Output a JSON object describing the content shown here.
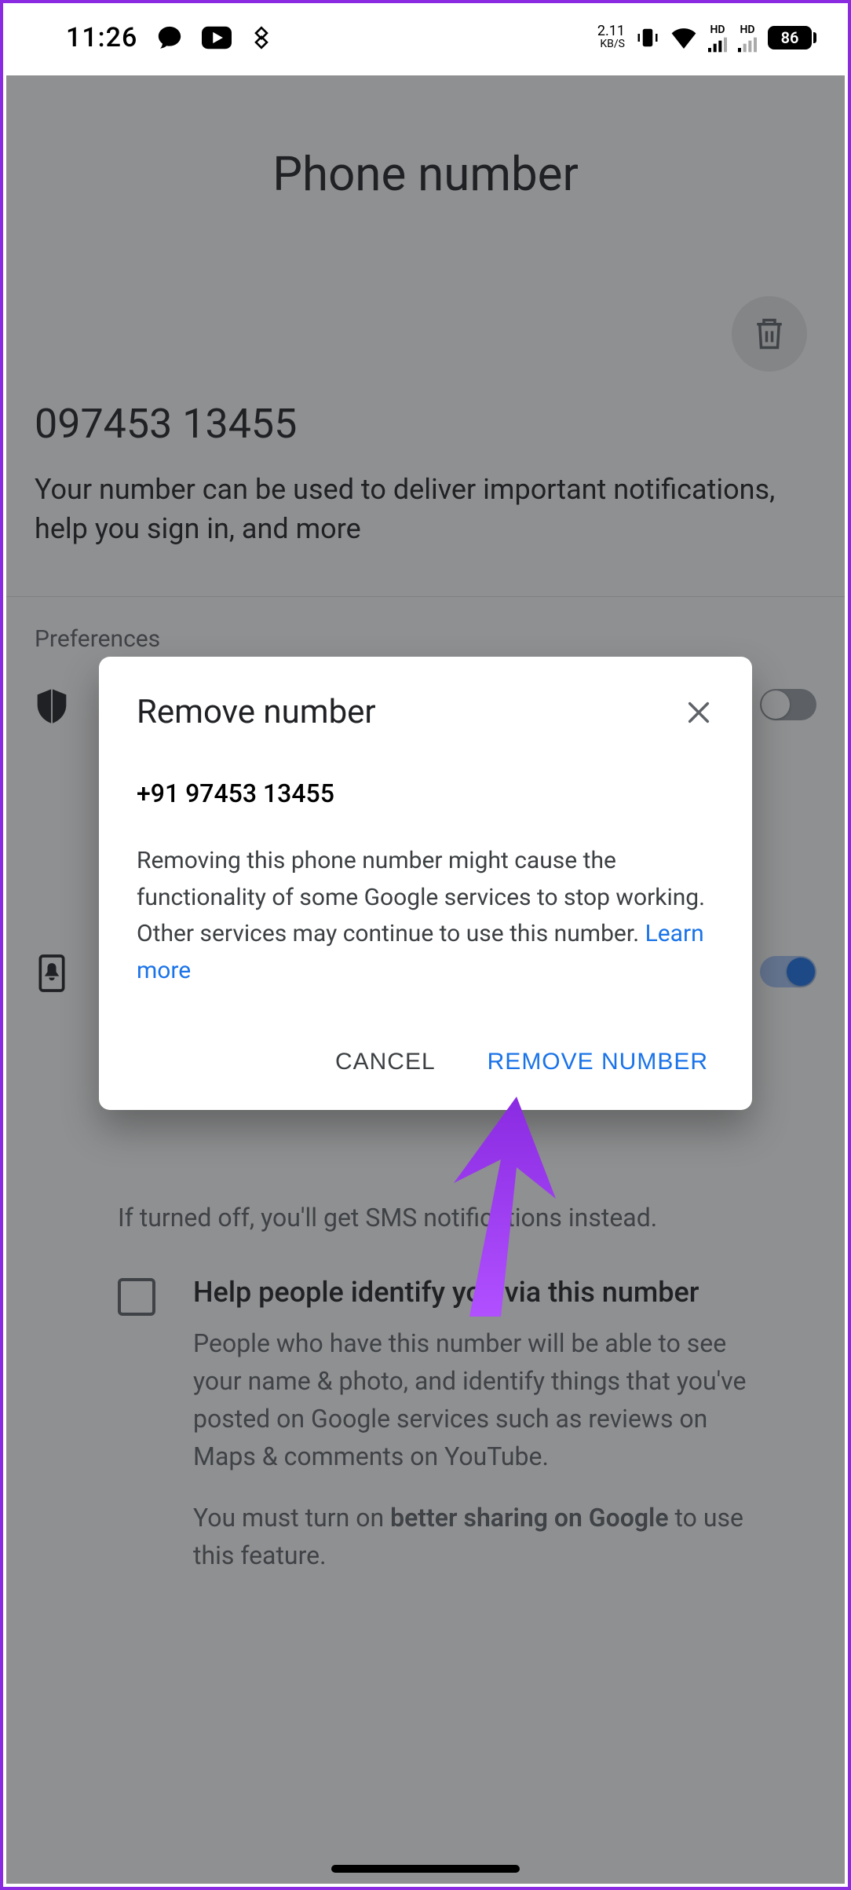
{
  "status": {
    "time": "11:26",
    "net_speed_value": "2.11",
    "net_speed_unit": "KB/S",
    "hd1": "HD",
    "hd2": "HD",
    "battery": "86"
  },
  "page": {
    "title": "Phone number",
    "number": "097453 13455",
    "desc": "Your number can be used to deliver important notifications, help you sign in, and more",
    "preferences_label": "Preferences",
    "orphan_text_line1": "If turned off, you'll get SMS notifications instead.",
    "checkbox": {
      "title": "Help people identify you via this number",
      "text": "People who have this number will be able to see your name & photo, and identify things that you've posted on Google services such as reviews on Maps & comments on YouTube.",
      "note_prefix": "You must turn on ",
      "note_bold": "better sharing on Google",
      "note_suffix": " to use this feature."
    }
  },
  "dialog": {
    "title": "Remove number",
    "number": "+91 97453 13455",
    "body": "Removing this phone number might cause the functionality of some Google services to stop working. Other services may continue to use this number. ",
    "learn_more": "Learn more",
    "cancel": "CANCEL",
    "remove": "REMOVE NUMBER"
  }
}
